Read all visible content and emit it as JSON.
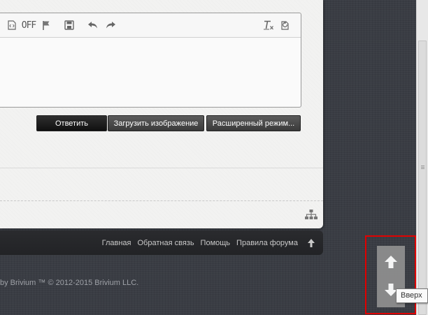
{
  "editor": {
    "toolbar": {
      "icons": [
        "html-tag-icon",
        "off-toggle-icon",
        "flag-icon",
        "save-icon",
        "undo-icon",
        "redo-icon",
        "remove-format-icon",
        "restore-draft-icon"
      ],
      "off_label": "OFF"
    }
  },
  "actions": {
    "reply_label": "Ответить",
    "upload_label": "Загрузить изображение",
    "advanced_label": "Расширенный режим..."
  },
  "footer": {
    "links": [
      "Главная",
      "Обратная связь",
      "Помощь",
      "Правила форума"
    ],
    "copyright": "by Brivium ™ © 2012-2015 Brivium LLC."
  },
  "scroll_widget": {
    "icons": [
      "arrow-up-icon",
      "arrow-down-icon"
    ],
    "tooltip": "Вверх"
  },
  "colors": {
    "background": "#3a3d44",
    "panel": "#f2f2f1",
    "footer_bar": "#252629",
    "highlight": "#e00000",
    "scroller": "#8e8e8e"
  }
}
